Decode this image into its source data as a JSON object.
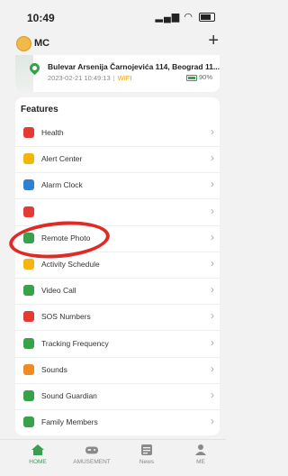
{
  "status_bar": {
    "time": "10:49"
  },
  "header": {
    "user_name": "MC",
    "add_label": "+"
  },
  "location": {
    "address": "Bulevar Arsenija Čarnojevića 114, Beograd 11...",
    "timestamp": "2023-02-21 10:49:13",
    "network": "WIFI",
    "battery": "90%"
  },
  "features": {
    "title": "Features",
    "items": [
      {
        "label": "Health",
        "icon": "heart-icon",
        "color": "#e53935"
      },
      {
        "label": "Alert Center",
        "icon": "message-icon",
        "color": "#f5b50a"
      },
      {
        "label": "Alarm Clock",
        "icon": "clock-icon",
        "color": "#2f7fd3"
      },
      {
        "label": "",
        "icon": "heart-icon",
        "color": "#e53935"
      },
      {
        "label": "Remote Photo",
        "icon": "camera-icon",
        "color": "#37a24a"
      },
      {
        "label": "Activity Schedule",
        "icon": "schedule-icon",
        "color": "#f5b50a"
      },
      {
        "label": "Video Call",
        "icon": "phone-icon",
        "color": "#37a24a"
      },
      {
        "label": "SOS Numbers",
        "icon": "sos-icon",
        "color": "#e53935"
      },
      {
        "label": "Tracking Frequency",
        "icon": "tracking-icon",
        "color": "#37a24a"
      },
      {
        "label": "Sounds",
        "icon": "speaker-icon",
        "color": "#f08a24"
      },
      {
        "label": "Sound Guardian",
        "icon": "shield-icon",
        "color": "#37a24a"
      },
      {
        "label": "Family Members",
        "icon": "person-icon",
        "color": "#37a24a"
      }
    ]
  },
  "tabbar": {
    "home": "HOME",
    "amusement": "AMUSEMENT",
    "news": "News",
    "me": "ME"
  },
  "colors": {
    "accent": "#3a9e4f",
    "highlight": "#e02a25"
  }
}
